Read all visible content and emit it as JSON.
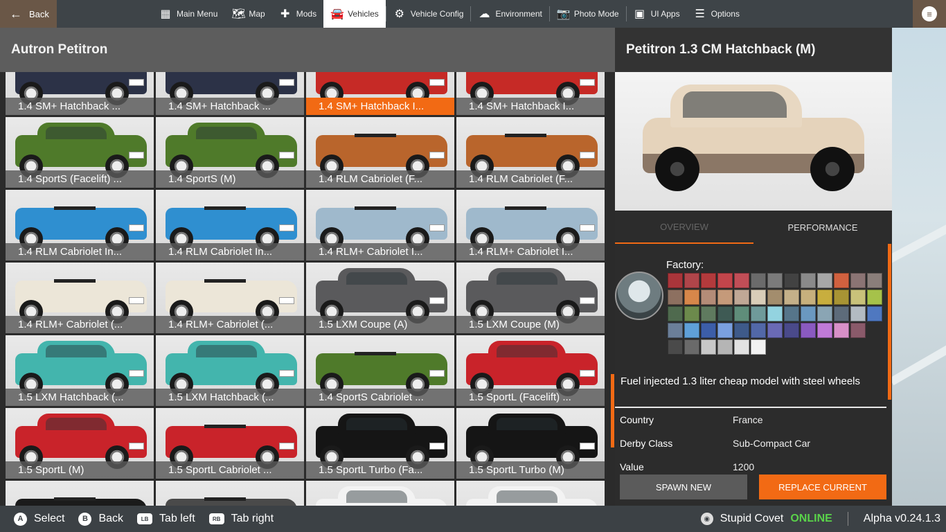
{
  "topbar": {
    "back_label": "Back",
    "nav": [
      {
        "label": "Main Menu",
        "icon": "main-menu-icon",
        "glyph": "▦"
      },
      {
        "label": "Map",
        "icon": "map-icon",
        "glyph": "🗺"
      },
      {
        "label": "Mods",
        "icon": "puzzle-icon",
        "glyph": "✚"
      },
      {
        "label": "Vehicles",
        "icon": "car-icon",
        "glyph": "🚘",
        "active": true
      },
      {
        "label": "Vehicle Config",
        "icon": "engine-icon",
        "glyph": "⚙"
      },
      {
        "label": "Environment",
        "icon": "weather-icon",
        "glyph": "☁"
      },
      {
        "label": "Photo Mode",
        "icon": "camera-icon",
        "glyph": "📷"
      },
      {
        "label": "UI Apps",
        "icon": "ui-apps-icon",
        "glyph": "▣"
      },
      {
        "label": "Options",
        "icon": "sliders-icon",
        "glyph": "☰"
      }
    ]
  },
  "left": {
    "title": "Autron Petitron",
    "tiles": [
      {
        "label": "1.4 SM+ Hatchback ...",
        "color": "#2c3247",
        "open": false
      },
      {
        "label": "1.4 SM+ Hatchback ...",
        "color": "#2c3247",
        "open": false
      },
      {
        "label": "1.4 SM+ Hatchback I...",
        "color": "#c62a26",
        "open": false,
        "selected": true
      },
      {
        "label": "1.4 SM+ Hatchback I...",
        "color": "#c62a26",
        "open": false
      },
      {
        "label": "1.4 SportS (Facelift) ...",
        "color": "#4f7a2a",
        "open": false
      },
      {
        "label": "1.4 SportS (M)",
        "color": "#4f7a2a",
        "open": false
      },
      {
        "label": "1.4 RLM Cabriolet (F...",
        "color": "#b9652c",
        "open": true
      },
      {
        "label": "1.4 RLM Cabriolet (F...",
        "color": "#b9652c",
        "open": true
      },
      {
        "label": "1.4 RLM Cabriolet In...",
        "color": "#2f8fd0",
        "open": true
      },
      {
        "label": "1.4 RLM Cabriolet In...",
        "color": "#2f8fd0",
        "open": true
      },
      {
        "label": "1.4 RLM+ Cabriolet I...",
        "color": "#9fb9cc",
        "open": true
      },
      {
        "label": "1.4 RLM+ Cabriolet I...",
        "color": "#9fb9cc",
        "open": true
      },
      {
        "label": "1.4 RLM+ Cabriolet (...",
        "color": "#ece6d8",
        "open": true
      },
      {
        "label": "1.4 RLM+ Cabriolet (...",
        "color": "#ece6d8",
        "open": true
      },
      {
        "label": "1.5 LXM Coupe (A)",
        "color": "#5a5a5c",
        "open": false
      },
      {
        "label": "1.5 LXM Coupe (M)",
        "color": "#5a5a5c",
        "open": false
      },
      {
        "label": "1.5 LXM Hatchback (...",
        "color": "#43b5ad",
        "open": false
      },
      {
        "label": "1.5 LXM Hatchback (...",
        "color": "#43b5ad",
        "open": false
      },
      {
        "label": "1.4 SportS Cabriolet ...",
        "color": "#4f7a2a",
        "open": true
      },
      {
        "label": "1.5 SportL (Facelift) ...",
        "color": "#c9232a",
        "open": false
      },
      {
        "label": "1.5 SportL (M)",
        "color": "#c9232a",
        "open": false
      },
      {
        "label": "1.5 SportL Cabriolet ...",
        "color": "#c9232a",
        "open": true
      },
      {
        "label": "1.5 SportL Turbo (Fa...",
        "color": "#151515",
        "open": false
      },
      {
        "label": "1.5 SportL Turbo (M)",
        "color": "#151515",
        "open": false
      },
      {
        "label": "",
        "color": "#1b1b1b",
        "open": true
      },
      {
        "label": "",
        "color": "#4a4a4a",
        "open": true
      },
      {
        "label": "",
        "color": "#f3f3f3",
        "open": false
      },
      {
        "label": "",
        "color": "#f3f3f3",
        "open": false
      }
    ]
  },
  "right": {
    "title": "Petitron 1.3 CM Hatchback (M)",
    "tabs": [
      "OVERVIEW",
      "PERFORMANCE"
    ],
    "factory_label": "Factory:",
    "swatches": [
      "#a9353a",
      "#b0454a",
      "#b33a3c",
      "#c3454b",
      "#c14e57",
      "#6b6b6b",
      "#7b7b7b",
      "#424242",
      "#8a8a8a",
      "#a7a7a7",
      "#d0613f",
      "#8b7474",
      "#8a7e7a",
      "#8d7060",
      "#d7874a",
      "#b48c78",
      "#c59a7a",
      "#c0a896",
      "#d9cdb8",
      "#a38d6d",
      "#c4b089",
      "#c7b07d",
      "#c8ae3e",
      "#a89434",
      "#c9c27a",
      "#a6c24a",
      "#4f6a4e",
      "#6c8a4c",
      "#5f7a5f",
      "#3e5a54",
      "#5f8d7a",
      "#6f9a9a",
      "#93d3e0",
      "#56758a",
      "#6a98c0",
      "#8aa5b4",
      "#5d6b7a",
      "#b3bbc2",
      "#4f78c0",
      "#6b7f99",
      "#5fa0d8",
      "#3c5ea8",
      "#7aa0e0",
      "#3e5a8a",
      "#5268a8",
      "#6a6ab5",
      "#4a4a8a",
      "#8a5ac0",
      "#c07ad8",
      "#d890c8",
      "#8a5a6a",
      "",
      "#4a4a4a",
      "#6a6a6a",
      "#c8c8c8",
      "#b5b5b5",
      "#e2e2e2",
      "#f2f2f2"
    ],
    "description": "Fuel injected 1.3 liter cheap model with steel wheels",
    "specs": [
      {
        "key": "Country",
        "value": "France"
      },
      {
        "key": "Derby Class",
        "value": "Sub-Compact Car"
      },
      {
        "key": "Value",
        "value": "1200"
      }
    ],
    "spawn_label": "SPAWN NEW",
    "replace_label": "REPLACE CURRENT"
  },
  "bottombar": {
    "hints": [
      {
        "key": "A",
        "label": "Select",
        "shape": "round"
      },
      {
        "key": "B",
        "label": "Back",
        "shape": "round"
      },
      {
        "key": "LB",
        "label": "Tab left",
        "shape": "rect"
      },
      {
        "key": "RB",
        "label": "Tab right",
        "shape": "rect"
      }
    ],
    "username": "Stupid Covet",
    "online": "ONLINE",
    "version": "Alpha v0.24.1.3"
  }
}
